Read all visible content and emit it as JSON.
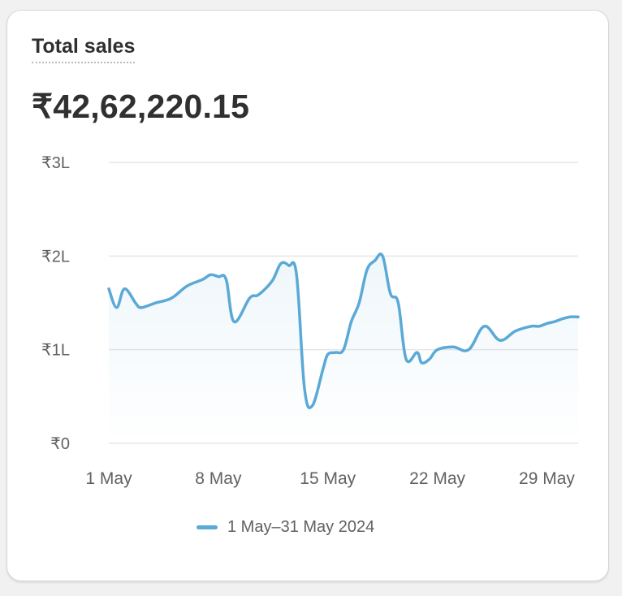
{
  "card": {
    "title": "Total sales",
    "total": "₹42,62,220.15"
  },
  "legend": {
    "label": "1 May–31 May 2024"
  },
  "colors": {
    "line": "#5aa9d6",
    "grid": "#e6e6e6",
    "text": "#303030",
    "muted": "#616161"
  },
  "chart_data": {
    "type": "line",
    "title": "Total sales",
    "ylabel": "",
    "xlabel": "",
    "ylim": [
      0,
      300000
    ],
    "y_ticks": [
      {
        "value": 0,
        "label": "₹0"
      },
      {
        "value": 100000,
        "label": "₹1L"
      },
      {
        "value": 200000,
        "label": "₹2L"
      },
      {
        "value": 300000,
        "label": "₹3L"
      }
    ],
    "x_tick_labels": [
      "1 May",
      "8 May",
      "15 May",
      "22 May",
      "29 May"
    ],
    "x_tick_days": [
      1,
      8,
      15,
      22,
      29
    ],
    "grid": true,
    "legend_position": "bottom-center",
    "series": [
      {
        "name": "1 May–31 May 2024",
        "x": [
          1,
          1.5,
          2,
          2.7,
          3,
          3.5,
          4,
          5,
          6,
          7,
          7.5,
          8,
          8.5,
          9,
          10,
          10.5,
          11,
          11.5,
          12,
          12.5,
          13,
          13.5,
          14,
          14.7,
          15,
          15.5,
          16,
          16.5,
          17,
          17.5,
          18,
          18.5,
          19,
          19.5,
          20,
          20.7,
          21,
          21.5,
          22,
          23,
          24,
          25,
          26,
          27,
          28,
          28.5,
          29,
          29.5,
          30,
          30.5,
          31
        ],
        "values": [
          165000,
          145000,
          165000,
          150000,
          145000,
          147000,
          150000,
          155000,
          168000,
          175000,
          180000,
          178000,
          175000,
          130000,
          155000,
          158000,
          165000,
          175000,
          192000,
          190000,
          180000,
          60000,
          40000,
          80000,
          95000,
          97000,
          100000,
          130000,
          150000,
          185000,
          195000,
          200000,
          160000,
          150000,
          90000,
          97000,
          86000,
          90000,
          100000,
          103000,
          100000,
          125000,
          110000,
          120000,
          125000,
          125000,
          128000,
          130000,
          133000,
          135000,
          135000
        ]
      }
    ]
  }
}
